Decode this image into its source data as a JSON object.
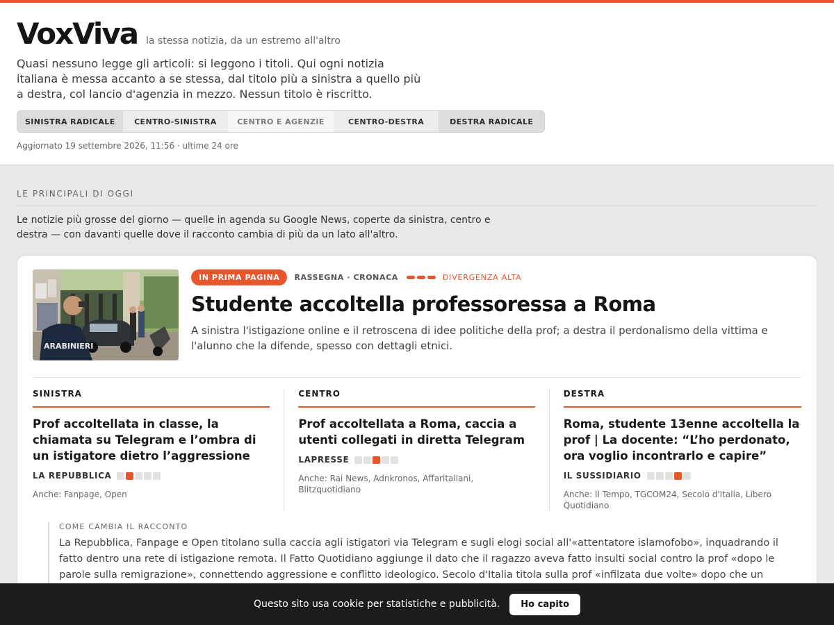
{
  "brand": {
    "name": "VoxViva",
    "tagline": "la stessa notizia, da un estremo all'altro"
  },
  "intro": "Quasi nessuno legge gli articoli: si leggono i titoli. Qui ogni notizia italiana è messa accanto a se stessa, dal titolo più a sinistra a quello più a destra, col lancio d'agenzia in mezzo. Nessun titolo è riscritto.",
  "spectrum": [
    "SINISTRA RADICALE",
    "CENTRO-SINISTRA",
    "CENTRO E AGENZIE",
    "CENTRO-DESTRA",
    "DESTRA RADICALE"
  ],
  "updated": "Aggiornato 19 settembre 2026, 11:56 · ultime 24 ore",
  "section": {
    "label": "LE PRINCIPALI DI OGGI",
    "description": "Le notizie più grosse del giorno — quelle in agenda su Google News, coperte da sinistra, centro e destra — con davanti quelle dove il racconto cambia di più da un lato all'altro."
  },
  "story": {
    "badge": "IN PRIMA PAGINA",
    "category": "RASSEGNA · CRONACA",
    "divergence": "DIVERGENZA ALTA",
    "headline": "Studente accoltella professoressa a Roma",
    "summary": "A sinistra l'istigazione online e il retroscena di idee politiche della prof; a destra il perdonalismo della vittima e l'alunno che la difende, spesso con dettagli etnici.",
    "image_text": "ARABINIERI",
    "columns": [
      {
        "label": "SINISTRA",
        "title": "Prof accoltellata in classe, la chiamata su Telegram e l’ombra di un istigatore dietro l’aggressione",
        "source": "LA REPUBBLICA",
        "position": 2,
        "also": "Anche: Fanpage, Open"
      },
      {
        "label": "CENTRO",
        "title": "Prof accoltellata a Roma, caccia a utenti collegati in diretta Telegram",
        "source": "LAPRESSE",
        "position": 3,
        "also": "Anche: Rai News, Adnkronos, Affaritaliani, Blitzquotidiano"
      },
      {
        "label": "DESTRA",
        "title": "Roma, studente 13enne accoltella la prof | La docente: “L’ho perdonato, ora voglio incontrarlo e capire”",
        "source": "IL SUSSIDIARIO",
        "position": 4,
        "also": "Anche: Il Tempo, TGCOM24, Secolo d'Italia, Libero Quotidiano"
      }
    ],
    "change_label": "COME CAMBIA IL RACCONTO",
    "change_text": "La Repubblica, Fanpage e Open titolano sulla caccia agli istigatori via Telegram e sugli elogi social all'«attentatore islamofobo», inquadrando il fatto dentro una rete di istigazione remota. Il Fatto Quotidiano aggiunge il dato che il ragazzo aveva fatto insulti social contro la prof «dopo le parole sulla remigrazione», connettendo aggressione e conflitto ideologico. Secolo d'Italia titola sulla prof «infilzata due volte» dopo che un «alunno congolese» l'ha «difesa», spostando il fuoco narrativo dalla violenza all'identità etnica del difensore e al suo gesto eroico. Libero descrive il movente come «un"
  },
  "cookie": {
    "text": "Questo sito usa cookie per statistiche e pubblicità.",
    "button": "Ho capito"
  },
  "colors": {
    "accent": "#e8542b",
    "cookie_bg": "#1c1c1c",
    "page_bg": "#e8e8e8"
  }
}
